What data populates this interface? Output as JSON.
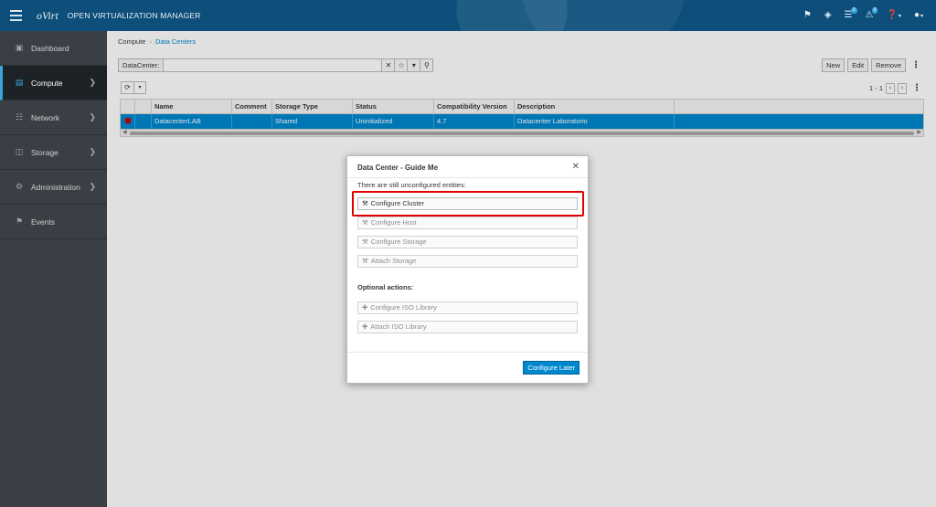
{
  "header": {
    "logo": "oVirt",
    "brand": "OPEN VIRTUALIZATION MANAGER",
    "tasks_badge": "0",
    "events_badge": "0"
  },
  "sidebar": {
    "items": [
      {
        "label": "Dashboard",
        "icon": "dashboard-icon"
      },
      {
        "label": "Compute",
        "icon": "compute-icon"
      },
      {
        "label": "Network",
        "icon": "network-icon"
      },
      {
        "label": "Storage",
        "icon": "storage-icon"
      },
      {
        "label": "Administration",
        "icon": "gear-icon"
      },
      {
        "label": "Events",
        "icon": "flag-icon"
      }
    ]
  },
  "breadcrumb": {
    "parent": "Compute",
    "current": "Data Centers"
  },
  "search": {
    "label": "DataCenter:",
    "value": ""
  },
  "actions": {
    "new": "New",
    "edit": "Edit",
    "remove": "Remove"
  },
  "pager": {
    "range": "1 - 1"
  },
  "table": {
    "columns": [
      "Name",
      "Comment",
      "Storage Type",
      "Status",
      "Compatibility Version",
      "Description"
    ],
    "rows": [
      [
        "DatacenterLAB",
        "",
        "Shared",
        "Uninitialized",
        "4.7",
        "Datacenter Laboratorio"
      ]
    ]
  },
  "modal": {
    "title": "Data Center - Guide Me",
    "intro": "There are still unconfigured entities:",
    "actions": [
      "Configure Cluster",
      "Configure Host",
      "Configure Storage",
      "Attach Storage"
    ],
    "optional_title": "Optional actions:",
    "optional": [
      "Configure ISO Library",
      "Attach ISO Library"
    ],
    "later": "Configure Later"
  }
}
